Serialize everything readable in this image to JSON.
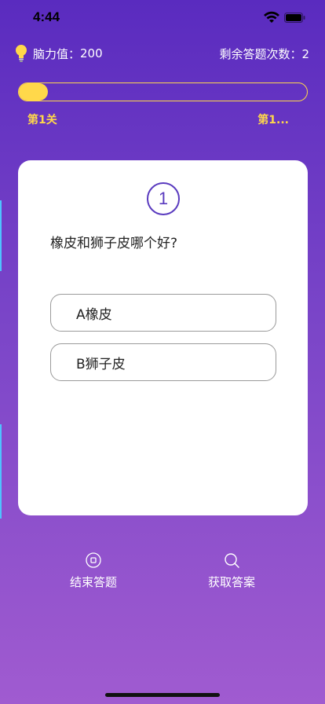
{
  "status_bar": {
    "time": "4:44"
  },
  "header": {
    "brain_label": "脑力值：",
    "brain_value": "200",
    "remaining_label": "剩余答题次数：",
    "remaining_value": "2"
  },
  "progress": {
    "fraction": 0.1,
    "level_start": "第1关",
    "level_end": "第1..."
  },
  "question": {
    "number": "1",
    "text": "橡皮和狮子皮哪个好?",
    "options": [
      {
        "label": "A橡皮"
      },
      {
        "label": "B狮子皮"
      }
    ]
  },
  "actions": {
    "end_label": "结束答题",
    "answer_label": "获取答案"
  },
  "colors": {
    "accent_yellow": "#ffd84a",
    "primary_purple": "#5a3bbf"
  },
  "icons": {
    "brain": "lightbulb-icon",
    "end": "stop-circle-icon",
    "answer": "search-icon"
  }
}
